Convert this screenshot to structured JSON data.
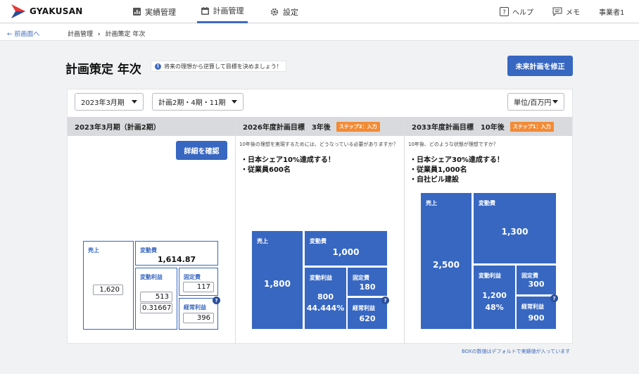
{
  "app": {
    "logo_text": "GYAKUSAN"
  },
  "nav": [
    {
      "label": "実績管理",
      "icon": "bar-chart-icon"
    },
    {
      "label": "計画管理",
      "icon": "calendar-icon"
    },
    {
      "label": "設定",
      "icon": "gear-icon"
    }
  ],
  "header_right": {
    "help": "ヘルプ",
    "memo": "メモ",
    "user": "事業者1"
  },
  "breadcrumb": {
    "back": "前画面へ",
    "level1": "計画管理",
    "level2": "計画策定 年次"
  },
  "page": {
    "title": "計画策定 年次",
    "hint": "将来の理想から逆算して目標を決めましょう！",
    "fix_button": "未来計画を修正"
  },
  "filters": {
    "period": "2023年3月期",
    "plan": "計画2期・4期・11期",
    "unit": "単位/百万円"
  },
  "col1": {
    "heading": "2023年3月期（計画2期）",
    "detail_button": "詳細を確認",
    "sales_label": "売上",
    "sales_value": "1,620",
    "var_cost_label": "変動費",
    "var_cost_value": "1,614.87",
    "var_profit_label": "変動利益",
    "var_profit_value": "513",
    "var_profit_rate": "0.316675",
    "fixed_label": "固定費",
    "fixed_value": "117",
    "ord_profit_label": "経常利益",
    "ord_profit_value": "396"
  },
  "col2": {
    "heading": "2026年度計画目標　3年後",
    "badge": "ステップ2：入力",
    "question": "10年後の理想を実現するためには、どうなっている必要がありますか？",
    "goals": [
      "・日本シェア10%達成する！",
      "・従業員600名"
    ],
    "sales_label": "売上",
    "sales_value": "1,800",
    "var_cost_label": "変動費",
    "var_cost_value": "1,000",
    "var_profit_label": "変動利益",
    "var_profit_value": "800",
    "var_profit_rate": "44.444%",
    "fixed_label": "固定費",
    "fixed_value": "180",
    "ord_profit_label": "経常利益",
    "ord_profit_value": "620"
  },
  "col3": {
    "heading": "2033年度計画目標　10年後",
    "badge": "ステップ1：入力",
    "question": "10年後、どのような状態が理想ですか？",
    "goals": [
      "・日本シェア30%達成する！",
      "・従業員1,000名",
      "・自社ビル建設"
    ],
    "sales_label": "売上",
    "sales_value": "2,500",
    "var_cost_label": "変動費",
    "var_cost_value": "1,300",
    "var_profit_label": "変動利益",
    "var_profit_value": "1,200",
    "var_profit_rate": "48%",
    "fixed_label": "固定費",
    "fixed_value": "300",
    "ord_profit_label": "経常利益",
    "ord_profit_value": "900"
  },
  "footnote": "BOXの数値はデフォルトで実績値が入っています",
  "colors": {
    "accent": "#3767c1",
    "badge": "#f28b36"
  }
}
